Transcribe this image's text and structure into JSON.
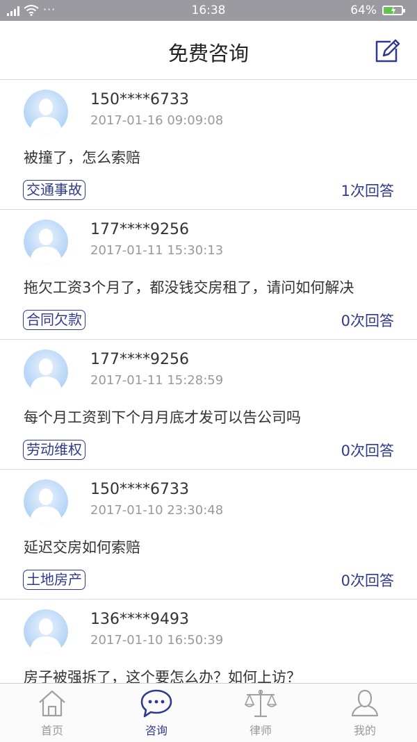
{
  "status_bar": {
    "time": "16:38",
    "battery": "64%",
    "battery_level": 0.64,
    "dots": "···"
  },
  "header": {
    "title": "免费咨询",
    "edit_icon": "edit-icon"
  },
  "consultations": [
    {
      "phone": "150****6733",
      "time": "2017-01-16 09:09:08",
      "question": "被撞了，怎么索赔",
      "tag": "交通事故",
      "answers": "1次回答"
    },
    {
      "phone": "177****9256",
      "time": "2017-01-11 15:30:13",
      "question": "拖欠工资3个月了，都没钱交房租了，请问如何解决",
      "tag": "合同欠款",
      "answers": "0次回答"
    },
    {
      "phone": "177****9256",
      "time": "2017-01-11 15:28:59",
      "question": "每个月工资到下个月月底才发可以告公司吗",
      "tag": "劳动维权",
      "answers": "0次回答"
    },
    {
      "phone": "150****6733",
      "time": "2017-01-10 23:30:48",
      "question": "延迟交房如何索赔",
      "tag": "土地房产",
      "answers": "0次回答"
    },
    {
      "phone": "136****9493",
      "time": "2017-01-10 16:50:39",
      "question": "房子被强拆了，这个要怎么办？如何上访？",
      "tag": "",
      "answers": ""
    }
  ],
  "tabbar": {
    "tabs": [
      {
        "label": "首页",
        "icon": "home-icon",
        "active": false
      },
      {
        "label": "咨询",
        "icon": "chat-icon",
        "active": true
      },
      {
        "label": "律师",
        "icon": "scale-icon",
        "active": false
      },
      {
        "label": "我的",
        "icon": "user-icon",
        "active": false
      }
    ]
  },
  "colors": {
    "accent": "#2f3a8f",
    "status_bar": "#9a9aa0",
    "avatar": "#a9d1f7",
    "muted_text": "#999999"
  }
}
